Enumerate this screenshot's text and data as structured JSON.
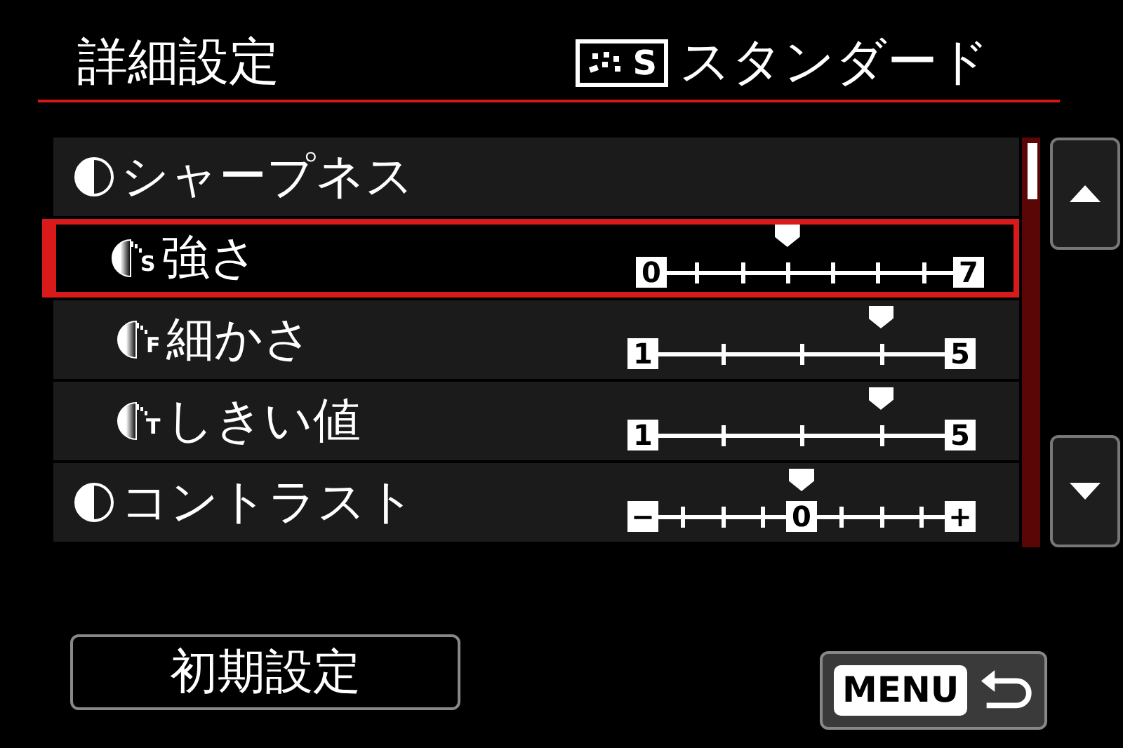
{
  "header": {
    "title": "詳細設定",
    "style_badge": "S",
    "style_name": "スタンダード"
  },
  "rows": [
    {
      "kind": "group",
      "label": "シャープネス",
      "selected": false
    },
    {
      "kind": "sub",
      "icon_letter": "S",
      "label": "強さ",
      "selected": true,
      "slider": {
        "kind": "range",
        "min_label": "0",
        "max_label": "7",
        "level": 0.4286
      }
    },
    {
      "kind": "sub",
      "icon_letter": "F",
      "label": "細かさ",
      "selected": false,
      "slider": {
        "kind": "range",
        "min_label": "1",
        "max_label": "5",
        "level": 0.75
      }
    },
    {
      "kind": "sub",
      "icon_letter": "T",
      "label": "しきい値",
      "selected": false,
      "slider": {
        "kind": "range",
        "min_label": "1",
        "max_label": "5",
        "level": 0.75
      }
    },
    {
      "kind": "group",
      "label": "コントラスト",
      "selected": false,
      "slider": {
        "kind": "bipolar",
        "min_label": "−",
        "mid_label": "0",
        "max_label": "+",
        "level": 0.5
      }
    }
  ],
  "buttons": {
    "reset": "初期設定",
    "menu": "MENU"
  }
}
